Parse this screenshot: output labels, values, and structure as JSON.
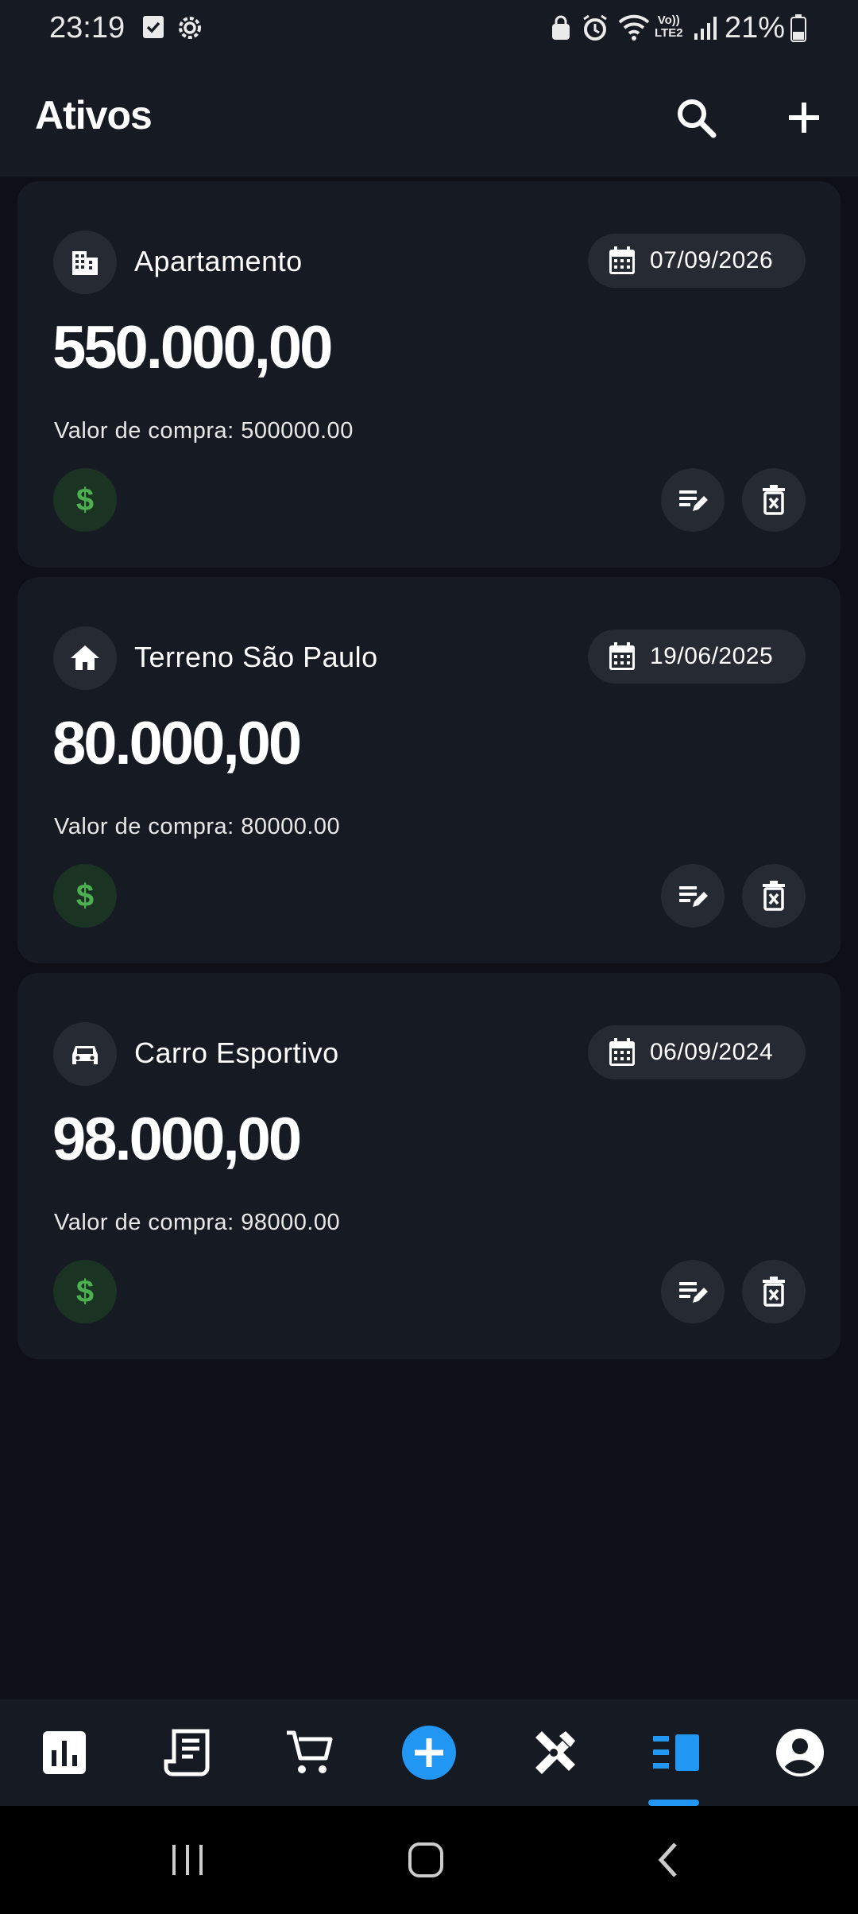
{
  "status_bar": {
    "time": "23:19",
    "battery": "21%",
    "network": "LTE2",
    "left_icons": [
      "checkbox-icon",
      "settings-icon"
    ],
    "right_icons": [
      "lock-icon",
      "alarm-icon",
      "wifi-icon",
      "volte-icon",
      "signal-icon",
      "battery-icon"
    ]
  },
  "app_bar": {
    "title": "Ativos",
    "actions": [
      "search-icon",
      "add-icon"
    ]
  },
  "assets": [
    {
      "icon": "building-icon",
      "name": "Apartamento",
      "date": "07/09/2026",
      "value": "550.000,00",
      "purchase": "Valor de compra: 500000.00"
    },
    {
      "icon": "home-icon",
      "name": "Terreno São Paulo",
      "date": "19/06/2025",
      "value": "80.000,00",
      "purchase": "Valor de compra: 80000.00"
    },
    {
      "icon": "car-icon",
      "name": "Carro Esportivo",
      "date": "06/09/2024",
      "value": "98.000,00",
      "purchase": "Valor de compra: 98000.00"
    }
  ],
  "card_actions": {
    "money_symbol": "$",
    "edit_icon": "edit-note-icon",
    "delete_icon": "delete-icon"
  },
  "bottom_nav": {
    "items": [
      "bar-chart-icon",
      "receipt-icon",
      "cart-icon",
      "add-circle-icon",
      "tools-icon",
      "assets-icon",
      "account-icon"
    ],
    "selected": "assets-icon",
    "accent_color": "#2196f3"
  },
  "colors": {
    "background": "#0d1017",
    "surface": "#161a22",
    "chip": "#262a32",
    "money_green": "#4caf50"
  }
}
